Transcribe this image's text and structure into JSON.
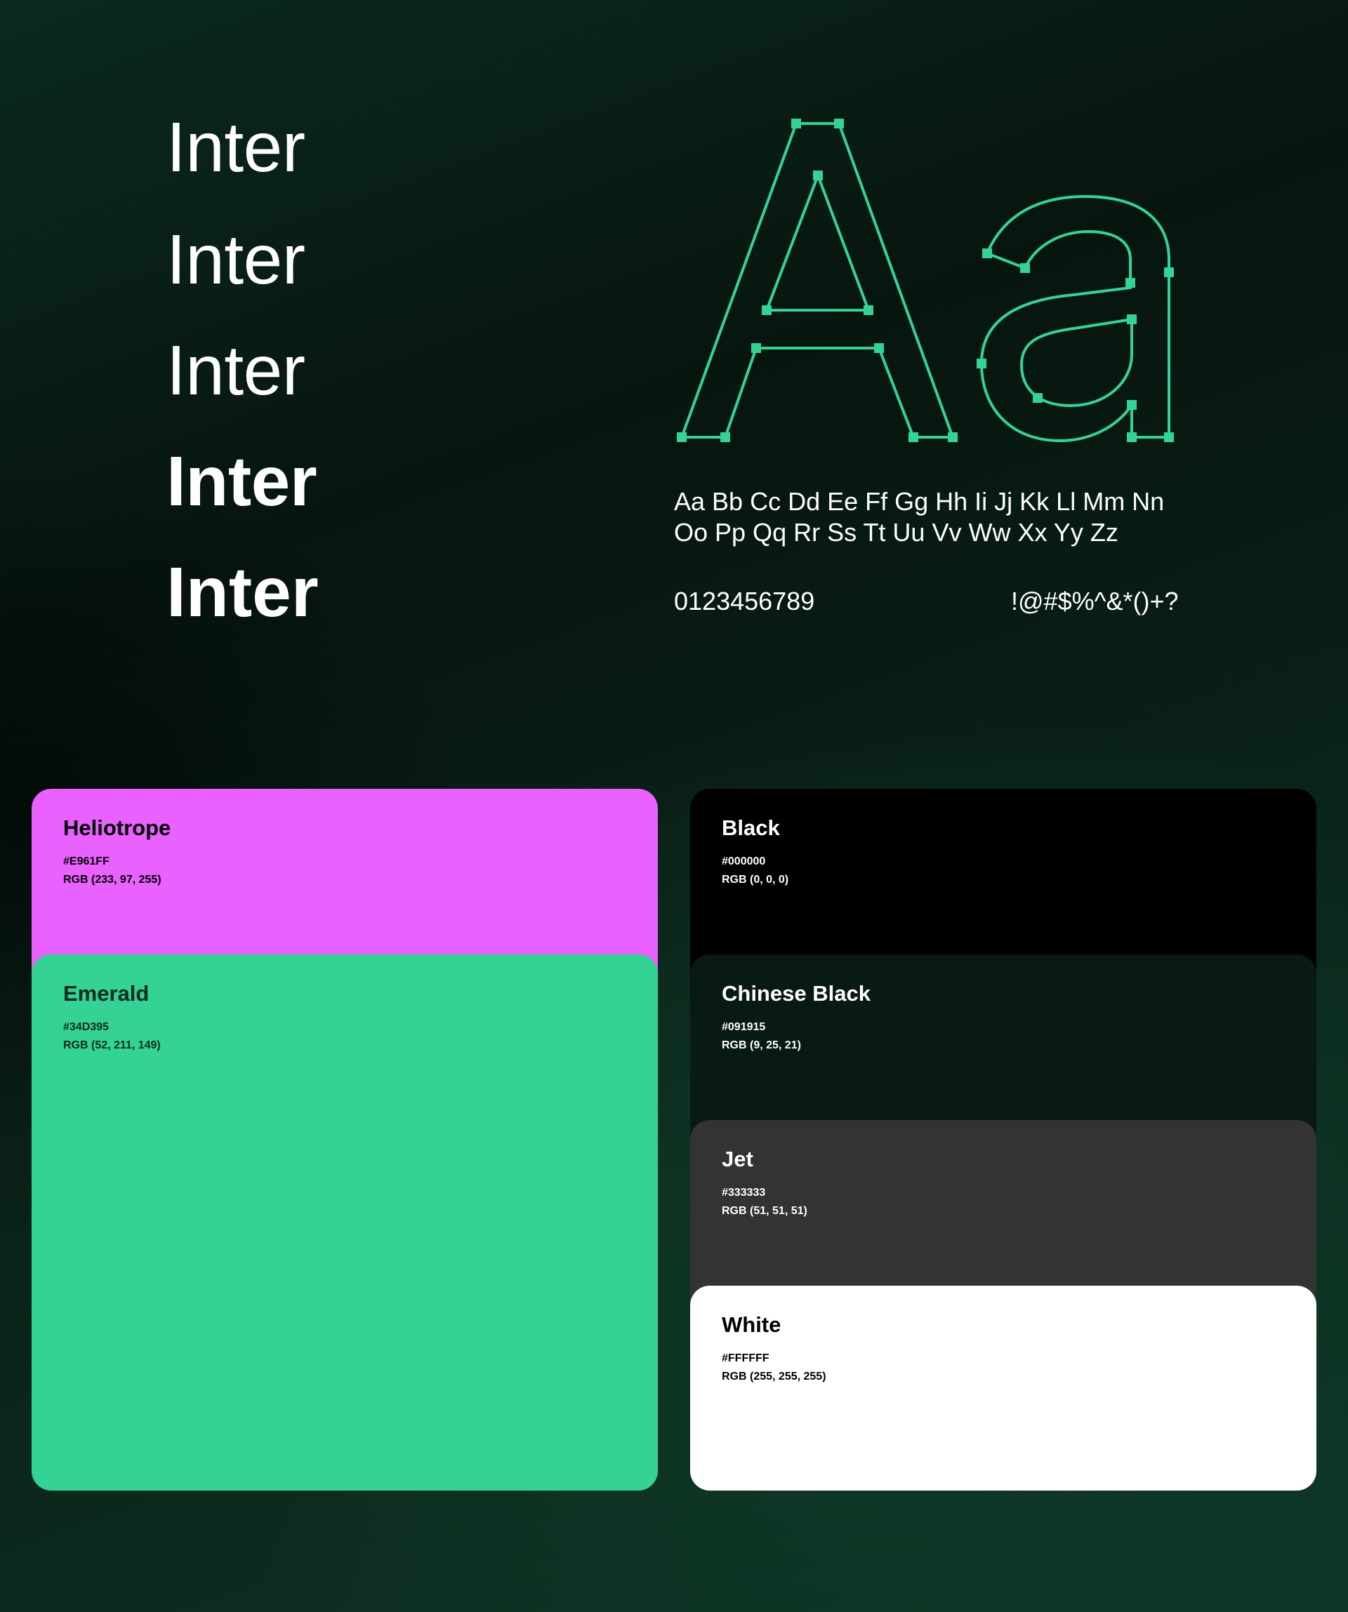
{
  "typeface": {
    "samples": [
      {
        "text": "Inter",
        "weight": 200
      },
      {
        "text": "Inter",
        "weight": 300
      },
      {
        "text": "Inter",
        "weight": 500
      },
      {
        "text": "Inter",
        "weight": 700
      },
      {
        "text": "Inter",
        "weight": 800
      }
    ],
    "specimen": "Aa",
    "alphabet_line1": "Aa Bb Cc Dd Ee Ff Gg Hh Ii Jj Kk Ll Mm Nn",
    "alphabet_line2": "Oo Pp Qq Rr Ss Tt Uu Vv Ww Xx Yy Zz",
    "digits": "0123456789",
    "symbols": "!@#$%^&*()+?"
  },
  "colors": {
    "accent": "#34D395",
    "primary": [
      {
        "name": "Heliotrope",
        "hex": "#E961FF",
        "rgb": "RGB (233, 97, 255)",
        "bg": "#E961FF",
        "fg": "#000000"
      },
      {
        "name": "Emerald",
        "hex": "#34D395",
        "rgb": "RGB (52, 211, 149)",
        "bg": "#34D395",
        "fg": "#0a2a1c"
      }
    ],
    "neutral": [
      {
        "name": "Black",
        "hex": "#000000",
        "rgb": "RGB (0, 0, 0)",
        "bg": "#000000",
        "fg": "#ffffff"
      },
      {
        "name": "Chinese Black",
        "hex": "#091915",
        "rgb": "RGB (9, 25, 21)",
        "bg": "#091915",
        "fg": "#ffffff"
      },
      {
        "name": "Jet",
        "hex": "#333333",
        "rgb": "RGB (51, 51, 51)",
        "bg": "#333333",
        "fg": "#ffffff"
      },
      {
        "name": "White",
        "hex": "#FFFFFF",
        "rgb": "RGB (255, 255, 255)",
        "bg": "#FFFFFF",
        "fg": "#000000"
      }
    ]
  }
}
